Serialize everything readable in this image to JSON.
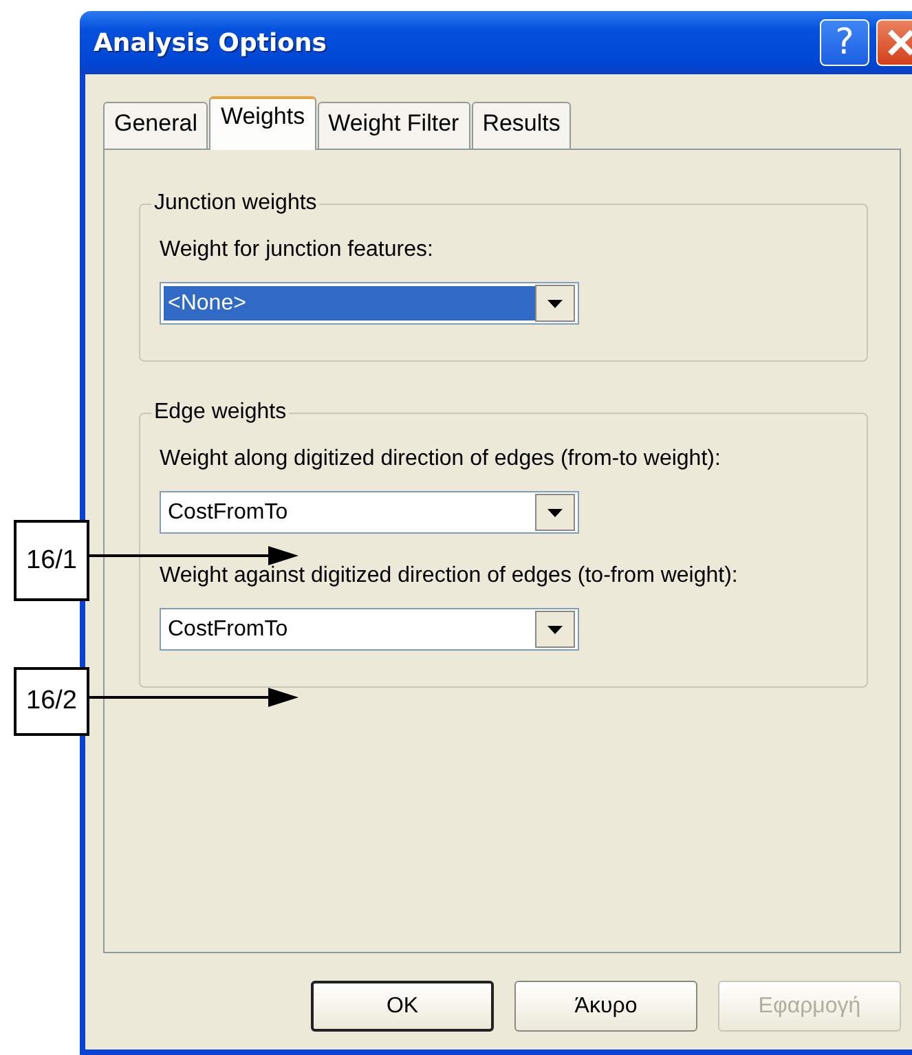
{
  "window": {
    "title": "Analysis Options"
  },
  "title_buttons": [
    {
      "kind": "help",
      "label": "?"
    },
    {
      "kind": "close"
    }
  ],
  "tabs": [
    {
      "label": "General",
      "selected": false
    },
    {
      "label": "Weights",
      "selected": true
    },
    {
      "label": "Weight Filter",
      "selected": false
    },
    {
      "label": "Results",
      "selected": false
    }
  ],
  "groups": [
    {
      "title": "Junction weights",
      "fields": [
        {
          "label": "Weight for junction features:",
          "value": "<None>",
          "selected": true
        }
      ]
    },
    {
      "title": "Edge weights",
      "fields": [
        {
          "label": "Weight along digitized direction of edges (from-to weight):",
          "value": "CostFromTo",
          "selected": false
        },
        {
          "label": "Weight against digitized direction of edges (to-from weight):",
          "value": "CostFromTo",
          "selected": false
        }
      ]
    }
  ],
  "buttons": [
    {
      "label": "OK",
      "default": true,
      "disabled": false
    },
    {
      "label": "Άκυρο",
      "default": false,
      "disabled": false
    },
    {
      "label": "Εφαρμογή",
      "default": false,
      "disabled": true
    }
  ],
  "annotations": [
    {
      "label": "16/1"
    },
    {
      "label": "16/2"
    }
  ]
}
